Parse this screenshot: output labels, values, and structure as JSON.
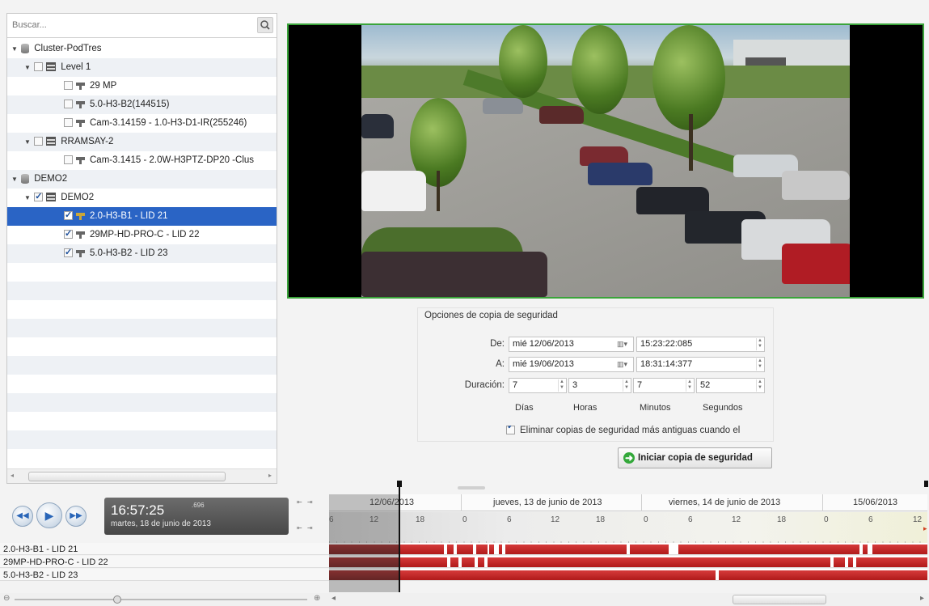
{
  "search": {
    "placeholder": "Buscar..."
  },
  "tree": [
    {
      "label": "Cluster-PodTres",
      "level": 0,
      "type": "db",
      "expanded": true,
      "checkbox": false
    },
    {
      "label": "Level 1",
      "level": 1,
      "type": "server",
      "expanded": true,
      "checkbox": true,
      "checked": false
    },
    {
      "label": "29 MP",
      "level": 2,
      "type": "camera",
      "checkbox": true,
      "checked": false
    },
    {
      "label": "5.0-H3-B2(144515)",
      "level": 2,
      "type": "camera",
      "checkbox": true,
      "checked": false
    },
    {
      "label": "Cam-3.14159 - 1.0-H3-D1-IR(255246)",
      "level": 2,
      "type": "camera",
      "checkbox": true,
      "checked": false
    },
    {
      "label": "RRAMSAY-2",
      "level": 1,
      "type": "server",
      "expanded": true,
      "checkbox": true,
      "checked": false
    },
    {
      "label": "Cam-3.1415 - 2.0W-H3PTZ-DP20 -Clus",
      "level": 2,
      "type": "camera",
      "checkbox": true,
      "checked": false
    },
    {
      "label": "DEMO2",
      "level": 0,
      "type": "db",
      "expanded": true,
      "checkbox": false
    },
    {
      "label": "DEMO2",
      "level": 1,
      "type": "server",
      "expanded": true,
      "checkbox": true,
      "checked": true
    },
    {
      "label": "2.0-H3-B1 - LID 21",
      "level": 2,
      "type": "camera",
      "checkbox": true,
      "checked": true,
      "selected": true
    },
    {
      "label": "29MP-HD-PRO-C - LID 22",
      "level": 2,
      "type": "camera",
      "checkbox": true,
      "checked": true
    },
    {
      "label": "5.0-H3-B2 - LID 23",
      "level": 2,
      "type": "camera",
      "checkbox": true,
      "checked": true
    }
  ],
  "backup": {
    "title": "Opciones de copia de seguridad",
    "from_label": "De:",
    "from_date": "mié 12/06/2013",
    "from_time": "15:23:22:085",
    "to_label": "A:",
    "to_date": "mié 19/06/2013",
    "to_time": "18:31:14:377",
    "duration_label": "Duración:",
    "days": "7",
    "hours": "3",
    "minutes": "7",
    "seconds": "52",
    "days_label": "Días",
    "hours_label": "Horas",
    "minutes_label": "Minutos",
    "seconds_label": "Segundos",
    "delete_old_label": "Eliminar copias de seguridad más antiguas cuando el",
    "delete_old_checked": true,
    "start_label": "Iniciar copia de seguridad"
  },
  "playback": {
    "time": "16:57:25",
    "ms": ".696",
    "date": "martes, 18 de junio de 2013"
  },
  "timeline": {
    "dates": [
      "12/06/2013",
      "jueves, 13 de junio de 2013",
      "viernes, 14 de junio de 2013",
      "15/06/2013"
    ],
    "hours": [
      "6",
      "12",
      "18",
      "0",
      "6",
      "12",
      "18",
      "0",
      "6",
      "12",
      "18",
      "0",
      "6",
      "12"
    ],
    "cameras": [
      "2.0-H3-B1 - LID 21",
      "29MP-HD-PRO-C - LID 22",
      "5.0-H3-B2 - LID 23"
    ]
  },
  "colors": {
    "selection": "#2a64c5",
    "recording": "#c52525",
    "video_border": "#3aa43a"
  }
}
